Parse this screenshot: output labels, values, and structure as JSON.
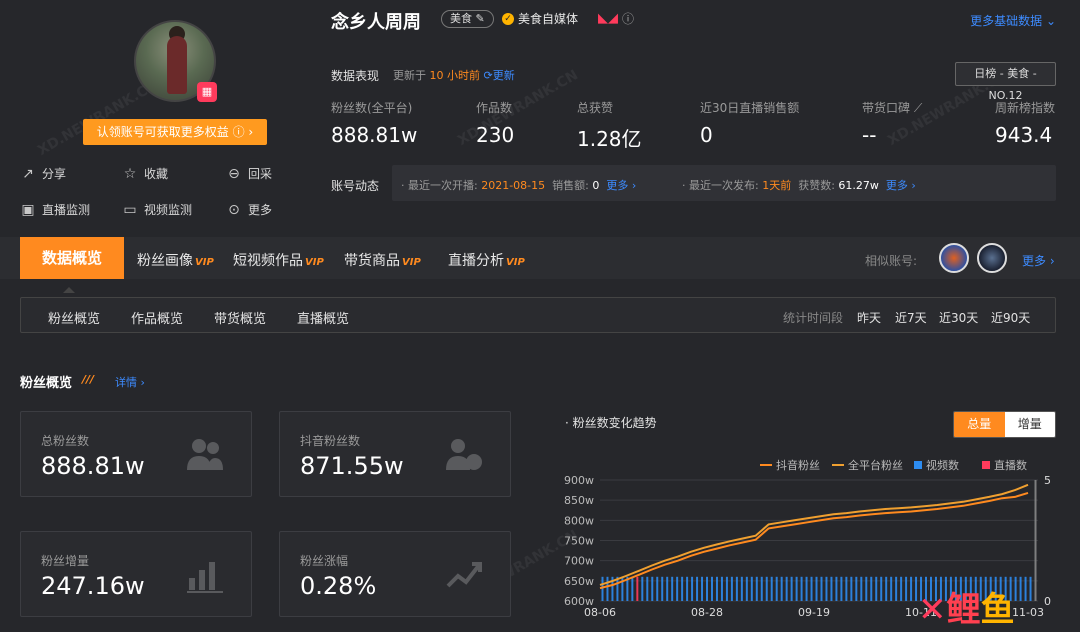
{
  "profile": {
    "claim_label": "认领账号可获取更多权益 ⓘ ›",
    "actions": [
      {
        "label": "分享",
        "icon": "share-icon"
      },
      {
        "label": "收藏",
        "icon": "star-icon"
      },
      {
        "label": "回采",
        "icon": "refresh-icon"
      },
      {
        "label": "直播监测",
        "icon": "live-icon"
      },
      {
        "label": "视频监测",
        "icon": "video-icon"
      },
      {
        "label": "更多",
        "icon": "more-icon"
      }
    ]
  },
  "header": {
    "name": "念乡人周周",
    "tag": "美食 ✎",
    "verified_label": "美食自媒体",
    "more_basic": "更多基础数据 ⌄",
    "data_perf_label": "数据表现",
    "updated_prefix": "更新于",
    "updated_time": "10 小时前",
    "refresh_label": "更新",
    "rank_badge": "日榜 - 美食 - NO.12"
  },
  "stats": [
    {
      "label": "粉丝数(全平台)",
      "value": "888.81w"
    },
    {
      "label": "作品数",
      "value": "230"
    },
    {
      "label": "总获赞",
      "value": "1.28亿"
    },
    {
      "label": "近30日直播销售额",
      "value": "0"
    },
    {
      "label": "带货口碑",
      "value": "--"
    },
    {
      "label": "周新榜指数",
      "value": "943.4"
    }
  ],
  "dynamics": {
    "label": "账号动态",
    "live_prefix": "· 最近一次开播:",
    "live_date": "2021-08-15",
    "sales_label": "销售额:",
    "sales_value": "0",
    "more1": "更多 ›",
    "post_prefix": "· 最近一次发布:",
    "post_time": "1天前",
    "likes_label": "获赞数:",
    "likes_value": "61.27w",
    "more2": "更多 ›"
  },
  "tabs": {
    "active": "数据概览",
    "items": [
      {
        "label": "粉丝画像",
        "vip": "VIP"
      },
      {
        "label": "短视频作品",
        "vip": "VIP"
      },
      {
        "label": "带货商品",
        "vip": "VIP"
      },
      {
        "label": "直播分析",
        "vip": "VIP"
      }
    ],
    "similar_label": "相似账号:",
    "more": "更多 ›"
  },
  "subtabs": [
    "粉丝概览",
    "作品概览",
    "带货概览",
    "直播概览"
  ],
  "range": {
    "label": "统计时间段",
    "options": [
      "昨天",
      "近7天",
      "近30天",
      "近90天"
    ],
    "selected": "近90天"
  },
  "section": {
    "title": "粉丝概览",
    "detail": "详情 ›"
  },
  "cards": [
    {
      "label": "总粉丝数",
      "value": "888.81w"
    },
    {
      "label": "抖音粉丝数",
      "value": "871.55w"
    },
    {
      "label": "粉丝增量",
      "value": "247.16w"
    },
    {
      "label": "粉丝涨幅",
      "value": "0.28%"
    }
  ],
  "chart": {
    "title": "· 粉丝数变化趋势",
    "toggle": [
      "总量",
      "增量"
    ],
    "legend": [
      "抖音粉丝",
      "全平台粉丝",
      "视频数",
      "直播数"
    ],
    "colors": {
      "douyin": "#ff8a1f",
      "all": "#f0a030",
      "video": "#2d8cf0",
      "live": "#ff3b5c"
    }
  },
  "chart_data": {
    "type": "line",
    "title": "粉丝数变化趋势",
    "xlabel": "",
    "ylabel": "",
    "x_ticks": [
      "08-06",
      "08-28",
      "09-19",
      "10-11",
      "11-03"
    ],
    "y_ticks": [
      "600w",
      "650w",
      "700w",
      "750w",
      "800w",
      "850w",
      "900w"
    ],
    "ylim": [
      600,
      900
    ],
    "y2_ticks": [
      "0",
      "5"
    ],
    "y2lim": [
      0,
      5
    ],
    "grid": true,
    "legend_position": "top-right",
    "series": [
      {
        "name": "抖音粉丝",
        "values": [
          632,
          640,
          652,
          665,
          678,
          690,
          700,
          712,
          722,
          730,
          738,
          745,
          752,
          780,
          785,
          790,
          795,
          800,
          805,
          808,
          812,
          815,
          818,
          820,
          822,
          825,
          828,
          832,
          836,
          842,
          848,
          855,
          858,
          868
        ]
      },
      {
        "name": "全平台粉丝",
        "values": [
          640,
          650,
          662,
          675,
          688,
          700,
          710,
          722,
          732,
          740,
          748,
          755,
          762,
          790,
          795,
          800,
          805,
          810,
          815,
          818,
          822,
          825,
          828,
          830,
          832,
          835,
          838,
          842,
          846,
          852,
          858,
          865,
          875,
          888
        ]
      }
    ],
    "bars": {
      "name": "视频数",
      "values": [
        1,
        1,
        1,
        1,
        1,
        1,
        1,
        1,
        1,
        1,
        1,
        1,
        1,
        1,
        1,
        1,
        1,
        1,
        1,
        1,
        1,
        1,
        1,
        1,
        1,
        1,
        1,
        1,
        1,
        1,
        1,
        1,
        1,
        1,
        1,
        1,
        1,
        1,
        1,
        1,
        1,
        1,
        1,
        1,
        1,
        1,
        1,
        1,
        1,
        1,
        1,
        1,
        1,
        1,
        1,
        1,
        1,
        1,
        1,
        1,
        1,
        1,
        1,
        1,
        1,
        1,
        1,
        1,
        1,
        1,
        1,
        1,
        1,
        1,
        1,
        1,
        1,
        1,
        1,
        1,
        1,
        1,
        1,
        1,
        1,
        1,
        1,
        5
      ]
    },
    "live_bar_index": 7,
    "live_bar_name": "直播数"
  }
}
